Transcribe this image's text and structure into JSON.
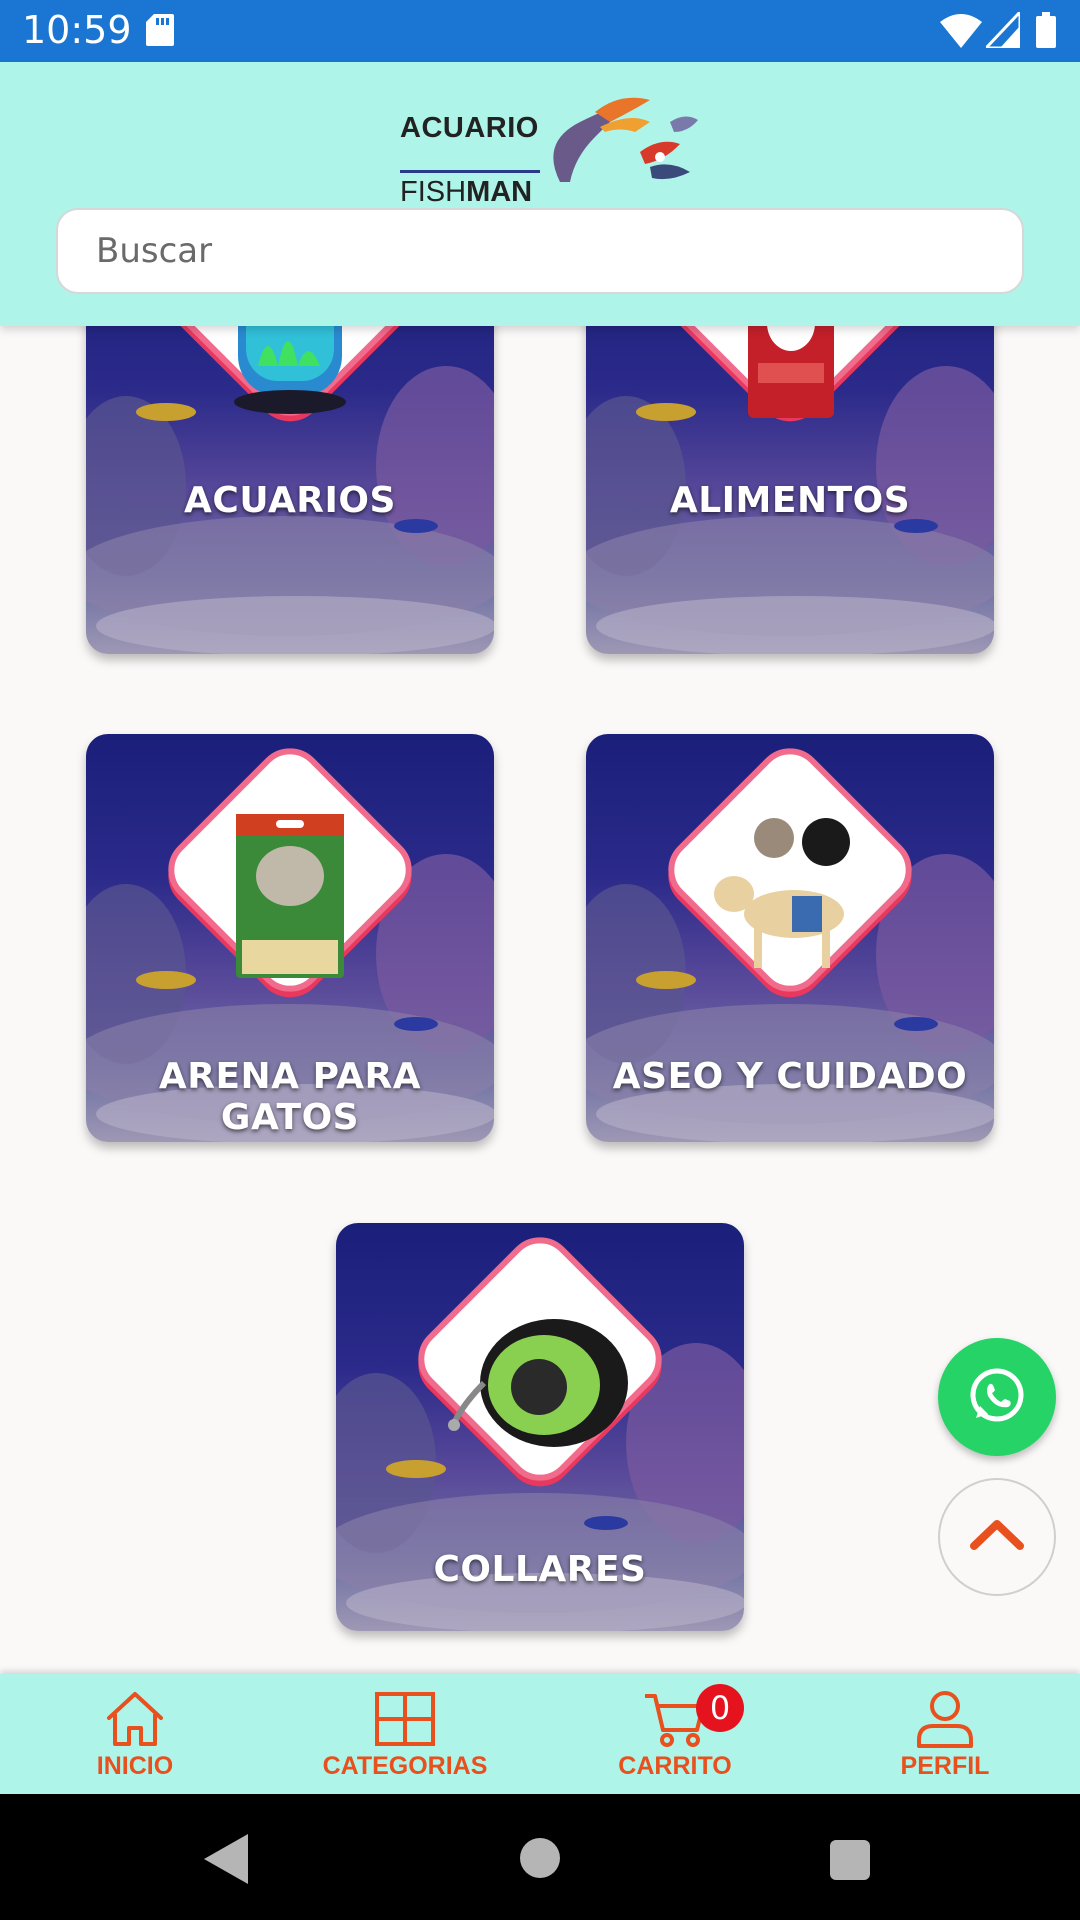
{
  "status_bar": {
    "time": "10:59"
  },
  "header": {
    "logo_line1": "ACUARIO",
    "logo_line2_a": "FISH",
    "logo_line2_b": "MAN",
    "search_placeholder": "Buscar"
  },
  "categories": [
    {
      "label": "ACUARIOS",
      "product_icon": "aquarium-tank"
    },
    {
      "label": "ALIMENTOS",
      "product_icon": "dog-food-bag"
    },
    {
      "label": "ARENA PARA GATOS",
      "product_icon": "cat-litter-bag"
    },
    {
      "label": "ASEO Y CUIDADO",
      "product_icon": "dog-diaper"
    },
    {
      "label": "COLLARES",
      "product_icon": "retractable-leash"
    }
  ],
  "fabs": {
    "whatsapp_icon": "whatsapp-icon",
    "scroll_top_icon": "chevron-up-icon"
  },
  "bottom_nav": {
    "items": [
      {
        "label": "INICIO",
        "icon": "home-icon"
      },
      {
        "label": "CATEGORIAS",
        "icon": "grid-icon"
      },
      {
        "label": "CARRITO",
        "icon": "cart-icon"
      },
      {
        "label": "PERFIL",
        "icon": "user-icon"
      }
    ],
    "cart_count": "0"
  },
  "colors": {
    "header_bg": "#aef4e9",
    "accent": "#e8501e",
    "status_bar": "#1a76d2",
    "whatsapp": "#25d366",
    "badge": "#e4131d"
  }
}
